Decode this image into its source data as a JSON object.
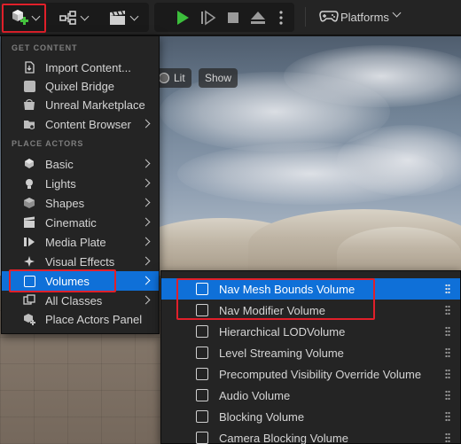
{
  "toolbar": {
    "platforms_label": "Platforms",
    "colors": {
      "play": "#3cbe3c",
      "add_badge": "#44c23d"
    }
  },
  "viewport": {
    "lit_label": "Lit",
    "show_label": "Show"
  },
  "quick_add_menu": {
    "get_content_header": "GET CONTENT",
    "place_actors_header": "PLACE ACTORS",
    "items": [
      {
        "label": "Import Content...",
        "icon": "import-icon",
        "submenu": false
      },
      {
        "label": "Quixel Bridge",
        "icon": "quixel-bridge-icon",
        "submenu": false
      },
      {
        "label": "Unreal Marketplace",
        "icon": "marketplace-icon",
        "submenu": false
      },
      {
        "label": "Content Browser",
        "icon": "content-browser-icon",
        "submenu": true
      },
      {
        "label": "Basic",
        "icon": "basic-actors-icon",
        "submenu": true
      },
      {
        "label": "Lights",
        "icon": "lights-icon",
        "submenu": true
      },
      {
        "label": "Shapes",
        "icon": "shapes-icon",
        "submenu": true
      },
      {
        "label": "Cinematic",
        "icon": "cinematic-icon",
        "submenu": true
      },
      {
        "label": "Media Plate",
        "icon": "media-plate-icon",
        "submenu": true
      },
      {
        "label": "Visual Effects",
        "icon": "visual-effects-icon",
        "submenu": true
      },
      {
        "label": "Volumes",
        "icon": "volumes-icon",
        "submenu": true,
        "selected": true
      },
      {
        "label": "All Classes",
        "icon": "all-classes-icon",
        "submenu": true
      },
      {
        "label": "Place Actors Panel",
        "icon": "place-actors-panel-icon",
        "submenu": false
      }
    ]
  },
  "volumes_submenu": {
    "items": [
      {
        "label": "Nav Mesh Bounds Volume",
        "icon": "nav-mesh-bounds-volume-icon",
        "selected": true
      },
      {
        "label": "Nav Modifier Volume",
        "icon": "nav-modifier-volume-icon"
      },
      {
        "label": "Hierarchical LODVolume",
        "icon": "hierarchical-lod-volume-icon"
      },
      {
        "label": "Level Streaming Volume",
        "icon": "level-streaming-volume-icon"
      },
      {
        "label": "Precomputed Visibility Override Volume",
        "icon": "precomputed-visibility-override-volume-icon"
      },
      {
        "label": "Audio Volume",
        "icon": "audio-volume-icon"
      },
      {
        "label": "Blocking Volume",
        "icon": "blocking-volume-icon"
      },
      {
        "label": "Camera Blocking Volume",
        "icon": "camera-blocking-volume-icon"
      }
    ]
  },
  "colors": {
    "selection_blue": "#0f70d8",
    "highlight_red": "#e0202a",
    "menu_bg": "#242424"
  }
}
